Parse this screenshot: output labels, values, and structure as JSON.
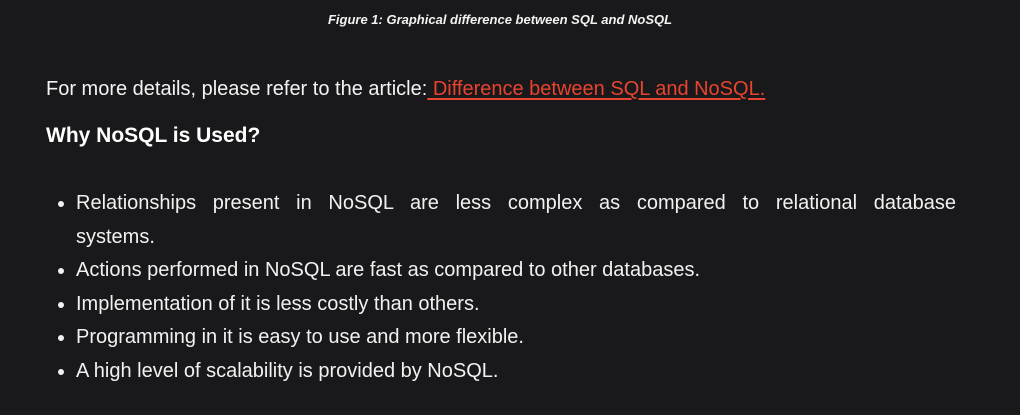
{
  "figure_caption": "Figure 1: Graphical difference between SQL and  NoSQL",
  "intro": {
    "text": "For more details, please refer to the article:",
    "link_text": " Difference between SQL and NoSQL."
  },
  "section_heading": "Why NoSQL is Used?",
  "reasons": [
    "Relationships present in NoSQL are less complex as compared to relational database systems.",
    "Actions performed in NoSQL are fast as compared to other databases.",
    "Implementation of it is less costly than others.",
    "Programming in it is easy to use and more flexible.",
    "A high level of scalability is provided by NoSQL."
  ],
  "colors": {
    "background": "#19181b",
    "text": "#f1f1f1",
    "link": "#e8442f"
  }
}
